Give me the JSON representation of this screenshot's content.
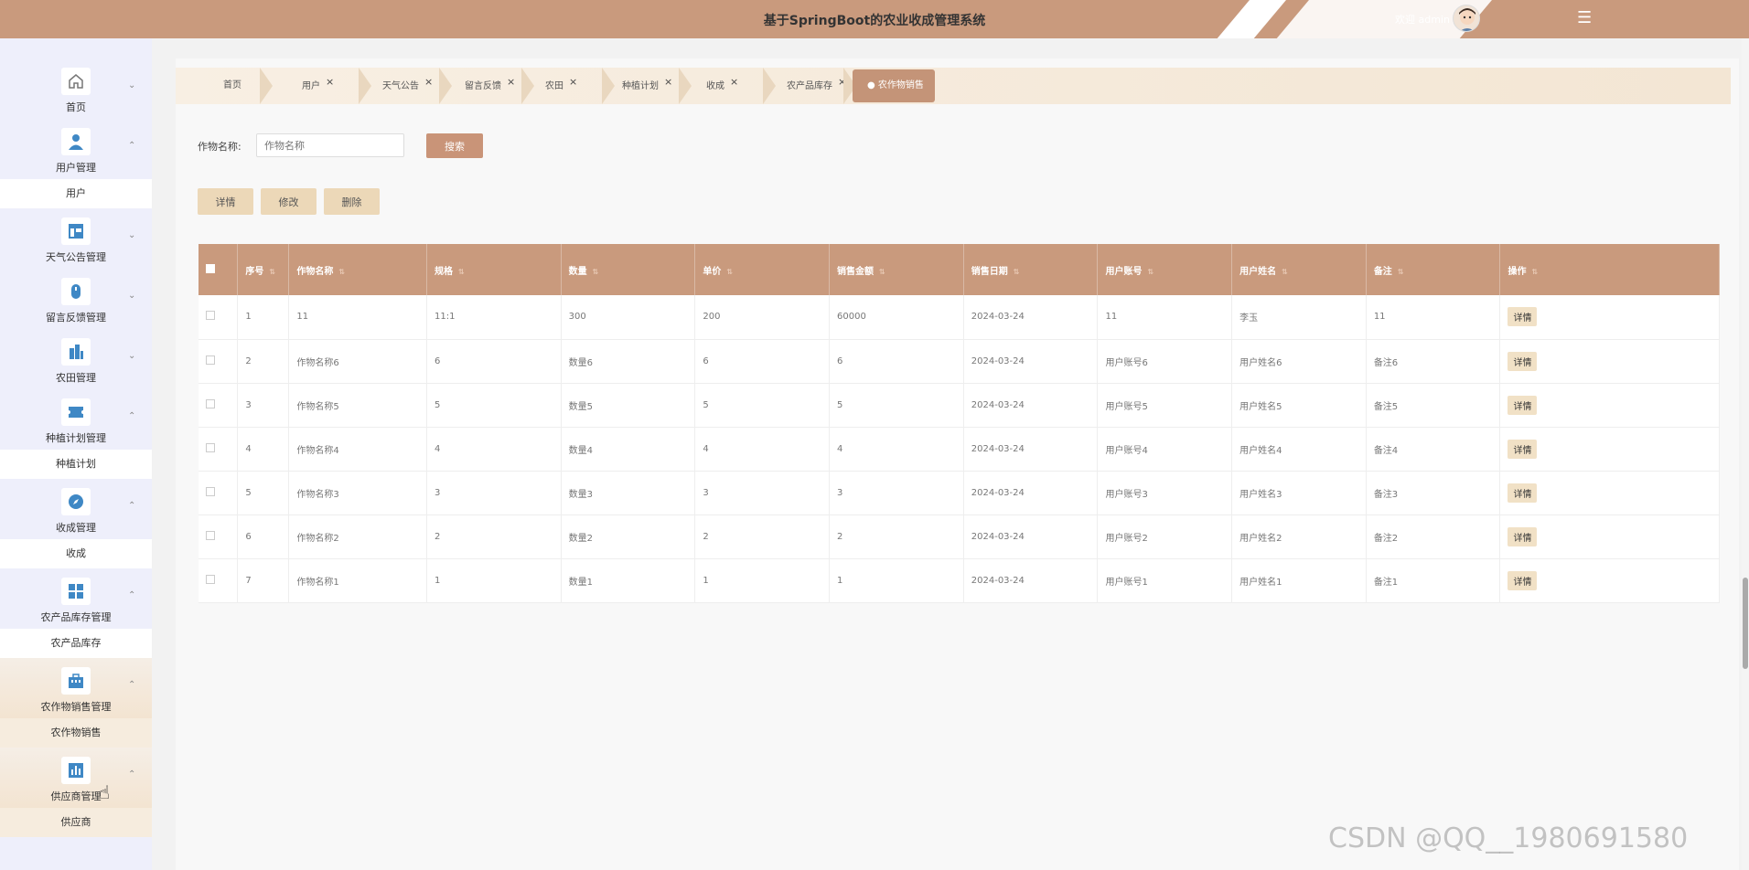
{
  "header": {
    "title": "基于SpringBoot的农业收成管理系统",
    "welcome": "欢迎 admin",
    "menu_icon": "menu-lines-icon",
    "colors": {
      "primary": "#c99a7d",
      "accent": "#ecd8b8"
    }
  },
  "sidebar": {
    "groups": [
      {
        "label": "首页",
        "icon": "home-icon",
        "chev": "⌄",
        "sub": ""
      },
      {
        "label": "用户管理",
        "icon": "user-icon",
        "chev": "⌃",
        "sub": "用户"
      },
      {
        "label": "天气公告管理",
        "icon": "layout-icon",
        "chev": "⌄",
        "sub": ""
      },
      {
        "label": "留言反馈管理",
        "icon": "feedback-icon",
        "chev": "⌄",
        "sub": ""
      },
      {
        "label": "农田管理",
        "icon": "building-icon",
        "chev": "⌄",
        "sub": ""
      },
      {
        "label": "种植计划管理",
        "icon": "ticket-icon",
        "chev": "⌃",
        "sub": "种植计划"
      },
      {
        "label": "收成管理",
        "icon": "compass-icon",
        "chev": "⌃",
        "sub": "收成"
      },
      {
        "label": "农产品库存管理",
        "icon": "grid-icon",
        "chev": "⌃",
        "sub": "农产品库存"
      },
      {
        "label": "农作物销售管理",
        "icon": "briefcase-icon",
        "chev": "⌃",
        "sub": "农作物销售"
      },
      {
        "label": "供应商管理",
        "icon": "chart-icon",
        "chev": "⌃",
        "sub": "供应商"
      }
    ]
  },
  "breadcrumb": {
    "items": [
      "首页",
      "用户",
      "天气公告",
      "留言反馈",
      "农田",
      "种植计划",
      "收成",
      "农产品库存"
    ],
    "active": "● 农作物销售",
    "close": "×"
  },
  "search": {
    "label": "作物名称:",
    "placeholder": "作物名称",
    "button": "搜索"
  },
  "actions": {
    "detail": "详情",
    "edit": "修改",
    "delete": "删除"
  },
  "table": {
    "headers": [
      "序号",
      "作物名称",
      "规格",
      "数量",
      "单价",
      "销售金额",
      "销售日期",
      "用户账号",
      "用户姓名",
      "备注",
      "操作"
    ],
    "row_button": "详情",
    "rows": [
      [
        "1",
        "11",
        "11:1",
        "300",
        "200",
        "60000",
        "2024-03-24",
        "11",
        "李玉",
        "11"
      ],
      [
        "2",
        "作物名称6",
        "6",
        "数量6",
        "6",
        "6",
        "2024-03-24",
        "用户账号6",
        "用户姓名6",
        "备注6"
      ],
      [
        "3",
        "作物名称5",
        "5",
        "数量5",
        "5",
        "5",
        "2024-03-24",
        "用户账号5",
        "用户姓名5",
        "备注5"
      ],
      [
        "4",
        "作物名称4",
        "4",
        "数量4",
        "4",
        "4",
        "2024-03-24",
        "用户账号4",
        "用户姓名4",
        "备注4"
      ],
      [
        "5",
        "作物名称3",
        "3",
        "数量3",
        "3",
        "3",
        "2024-03-24",
        "用户账号3",
        "用户姓名3",
        "备注3"
      ],
      [
        "6",
        "作物名称2",
        "2",
        "数量2",
        "2",
        "2",
        "2024-03-24",
        "用户账号2",
        "用户姓名2",
        "备注2"
      ],
      [
        "7",
        "作物名称1",
        "1",
        "数量1",
        "1",
        "1",
        "2024-03-24",
        "用户账号1",
        "用户姓名1",
        "备注1"
      ]
    ]
  },
  "watermark": "CSDN @QQ__1980691580"
}
